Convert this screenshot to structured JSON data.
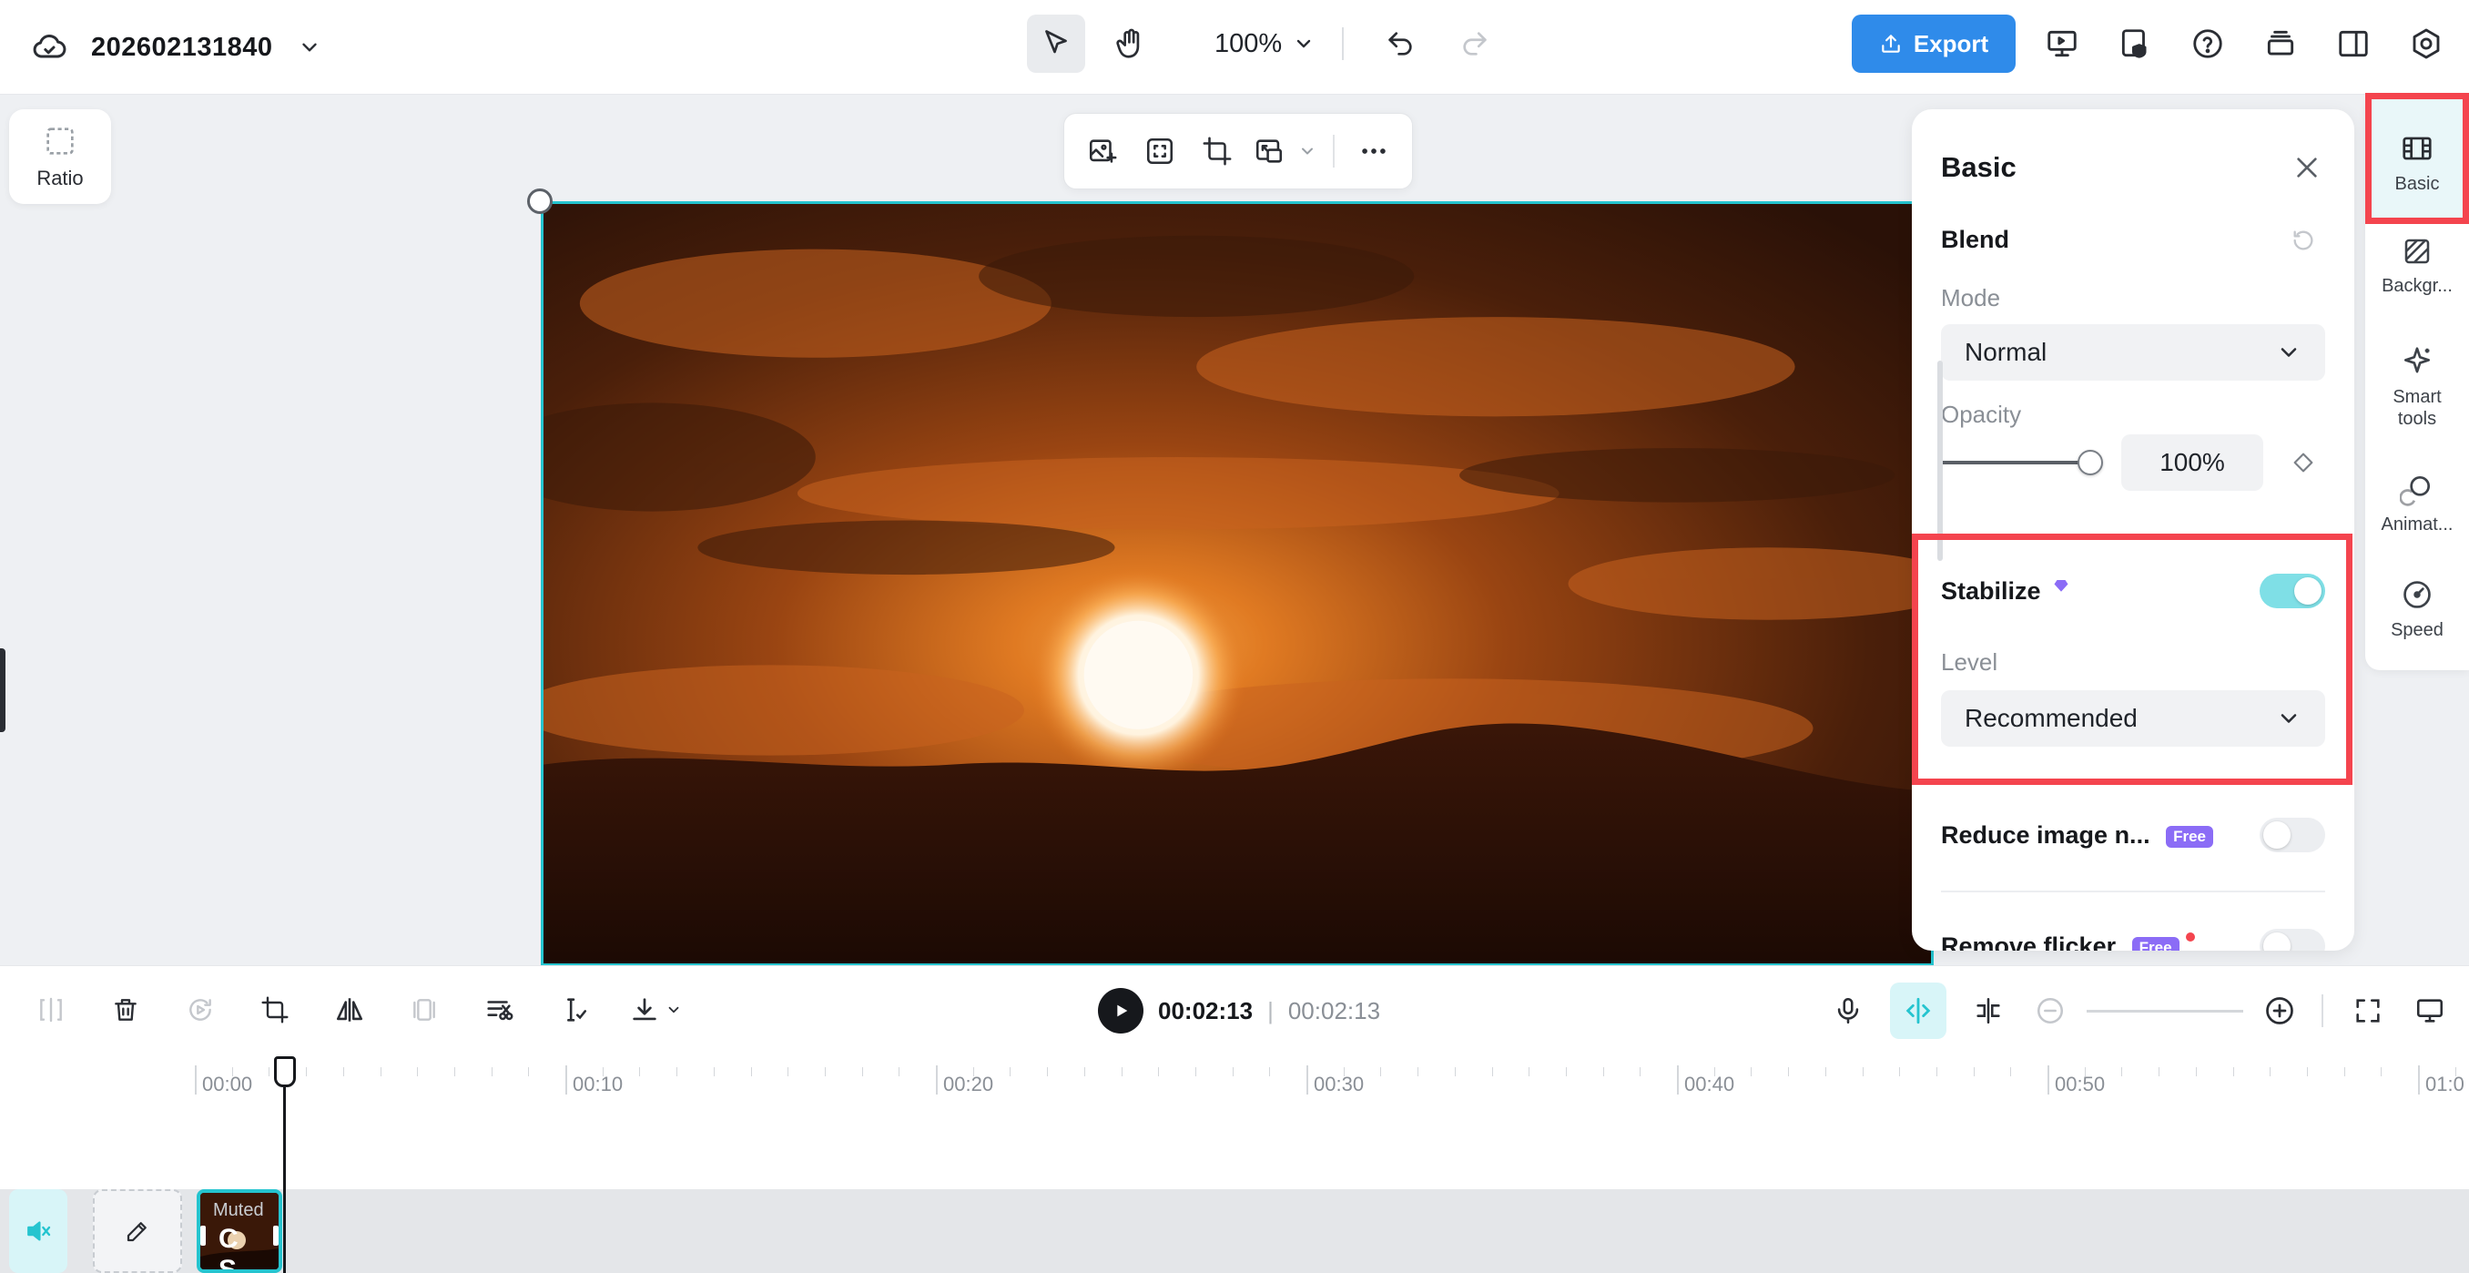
{
  "topbar": {
    "project_name": "202602131840",
    "zoom": "100%",
    "export_label": "Export"
  },
  "ratio": {
    "label": "Ratio"
  },
  "panel": {
    "title": "Basic",
    "blend": {
      "title": "Blend",
      "mode_label": "Mode",
      "mode_value": "Normal",
      "opacity_label": "Opacity",
      "opacity_value": "100%",
      "opacity_level": 1.0
    },
    "stabilize": {
      "title": "Stabilize",
      "enabled": true,
      "level_label": "Level",
      "level_value": "Recommended"
    },
    "reduce_noise": {
      "title": "Reduce image n...",
      "badge": "Free",
      "enabled": false
    },
    "remove_flicker": {
      "title": "Remove flicker",
      "badge": "Free",
      "enabled": false
    }
  },
  "rail": {
    "items": [
      {
        "label": "Basic",
        "icon": "film-icon"
      },
      {
        "label": "Backgr...",
        "icon": "background-icon"
      },
      {
        "label": "Smart tools",
        "icon": "sparkle-icon"
      },
      {
        "label": "Animat...",
        "icon": "animation-icon"
      },
      {
        "label": "Speed",
        "icon": "speedometer-icon"
      }
    ]
  },
  "timeline": {
    "current_time": "00:02:13",
    "separator": "|",
    "total_time": "00:02:13",
    "ruler": [
      "00:00",
      "00:10",
      "00:20",
      "00:30",
      "00:40",
      "00:50",
      "01:0"
    ],
    "clip": {
      "status": "Muted",
      "letters": "C S"
    }
  },
  "colors": {
    "accent": "#25c4cf",
    "export": "#2f8bea",
    "highlight": "#f4444e",
    "free_badge": "#8b6cf6"
  }
}
